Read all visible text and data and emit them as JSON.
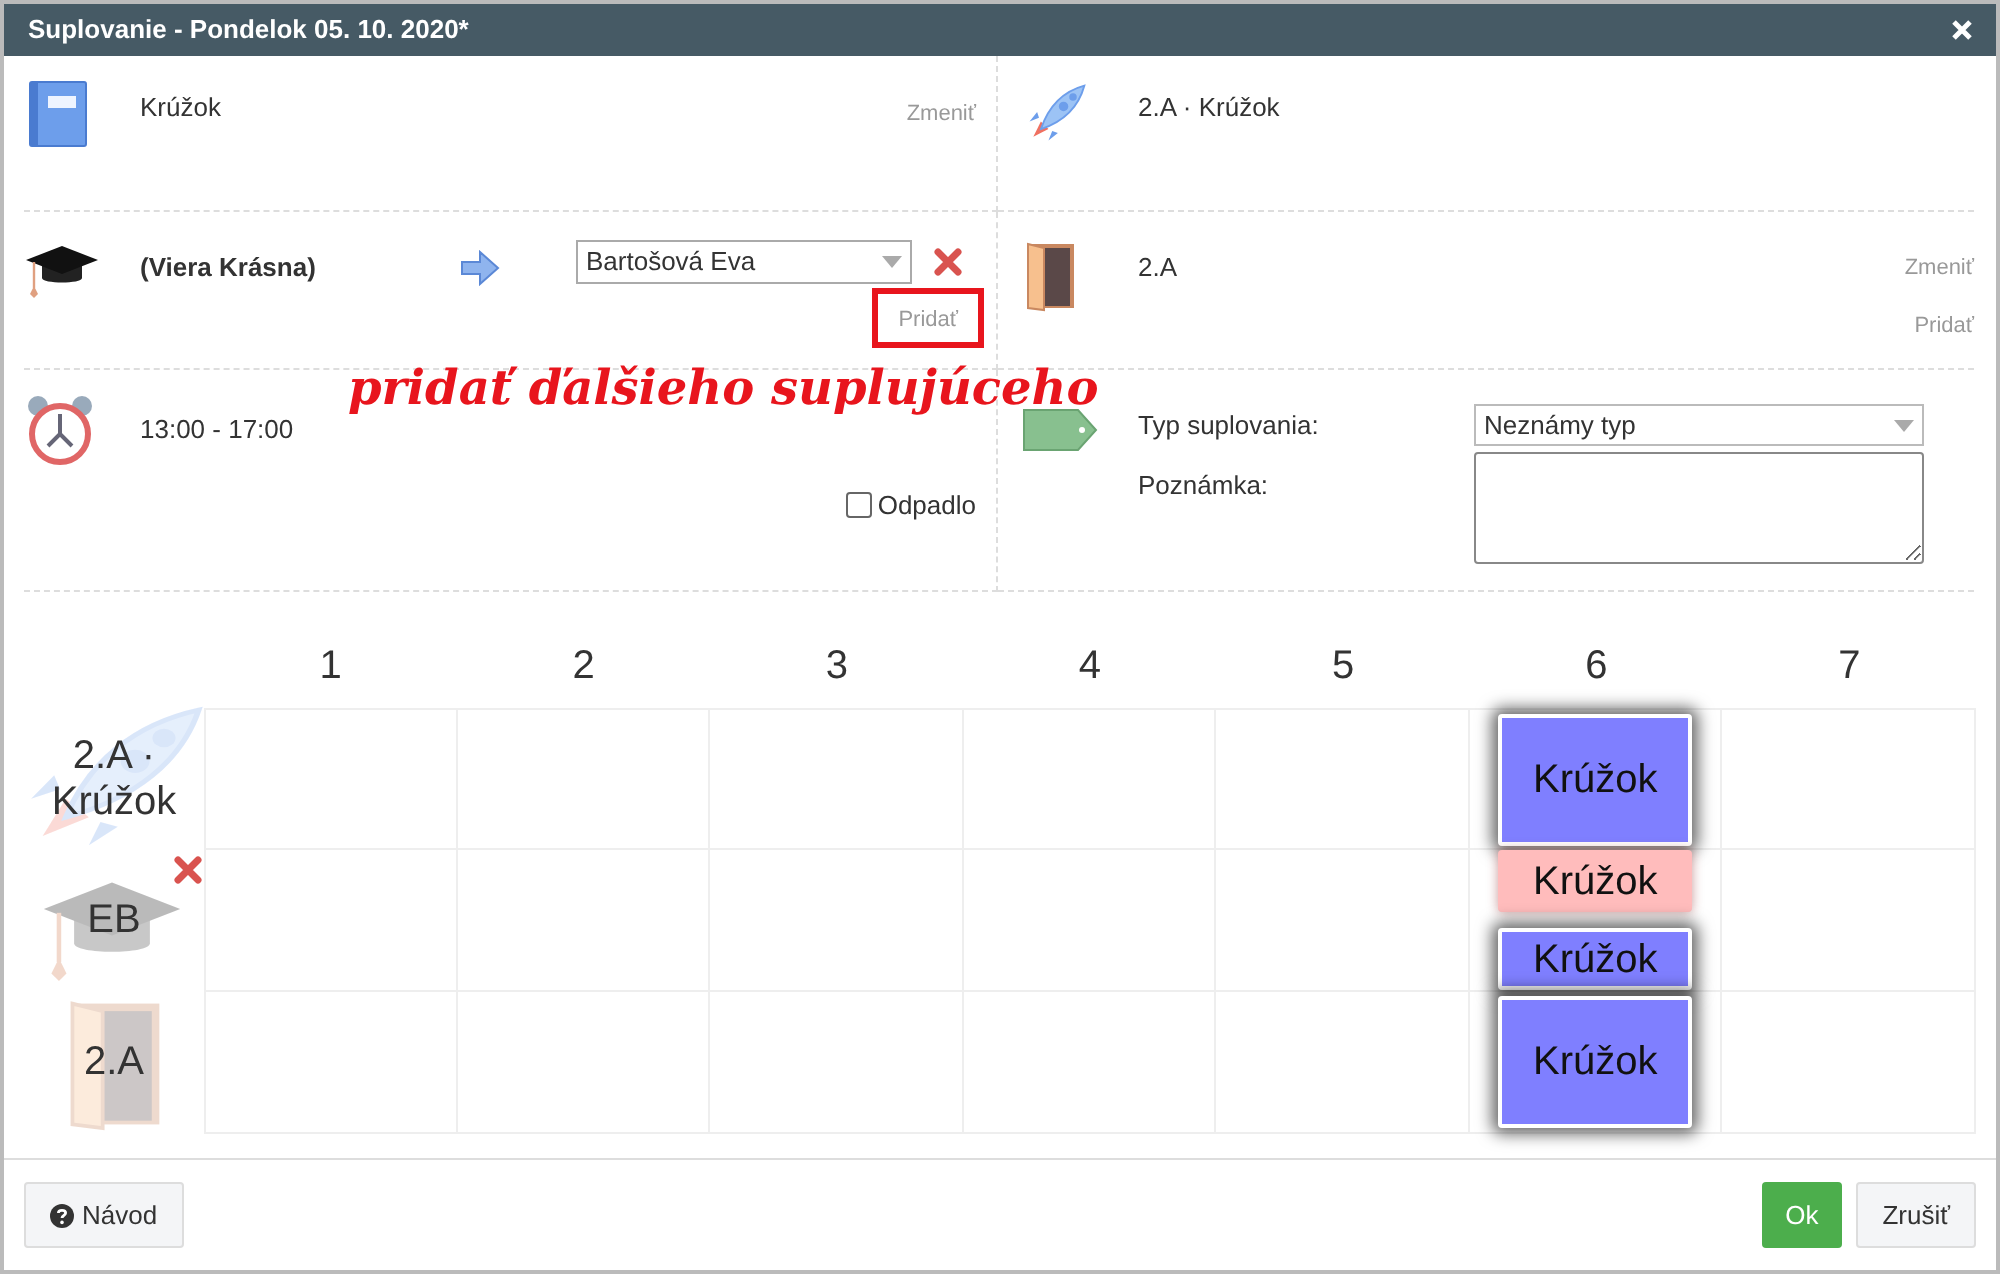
{
  "window": {
    "title": "Suplovanie - Pondelok 05. 10. 2020*"
  },
  "subject": {
    "text": "Krúžok",
    "change_link": "Zmeniť"
  },
  "group": {
    "text": "2.A · Krúžok"
  },
  "teacher": {
    "name": "(Viera Krásna)",
    "substitute": "Bartošová Eva",
    "add_link": "Pridať"
  },
  "room": {
    "text": "2.A",
    "change_link": "Zmeniť",
    "add_link": "Pridať"
  },
  "annotation": {
    "text": "pridať ďalšieho suplujúceho"
  },
  "time": {
    "text": "13:00 - 17:00"
  },
  "cancelled": {
    "label": "Odpadlo",
    "checked": false
  },
  "type": {
    "label": "Typ suplovania:",
    "value": "Neznámy typ"
  },
  "note": {
    "label": "Poznámka:"
  },
  "timetable": {
    "columns": [
      "1",
      "2",
      "3",
      "4",
      "5",
      "6",
      "7"
    ],
    "rows": [
      {
        "kind": "class",
        "label": "2.A · Krúžok",
        "removable": false,
        "cells": [
          {},
          {},
          {},
          {},
          {},
          {
            "lessons": [
              {
                "text": "Krúžok",
                "kind": "added"
              }
            ]
          },
          {}
        ]
      },
      {
        "kind": "teacher",
        "label": "EB",
        "removable": true,
        "cells": [
          {},
          {},
          {},
          {},
          {},
          {
            "lessons": [
              {
                "text": "Krúžok",
                "kind": "removed"
              },
              {
                "text": "Krúžok",
                "kind": "added"
              }
            ]
          },
          {}
        ]
      },
      {
        "kind": "room",
        "label": "2.A",
        "removable": false,
        "cells": [
          {},
          {},
          {},
          {},
          {},
          {
            "lessons": [
              {
                "text": "Krúžok",
                "kind": "added"
              }
            ]
          },
          {}
        ]
      }
    ]
  },
  "footer": {
    "help": "Návod",
    "ok": "Ok",
    "cancel": "Zrušiť"
  }
}
